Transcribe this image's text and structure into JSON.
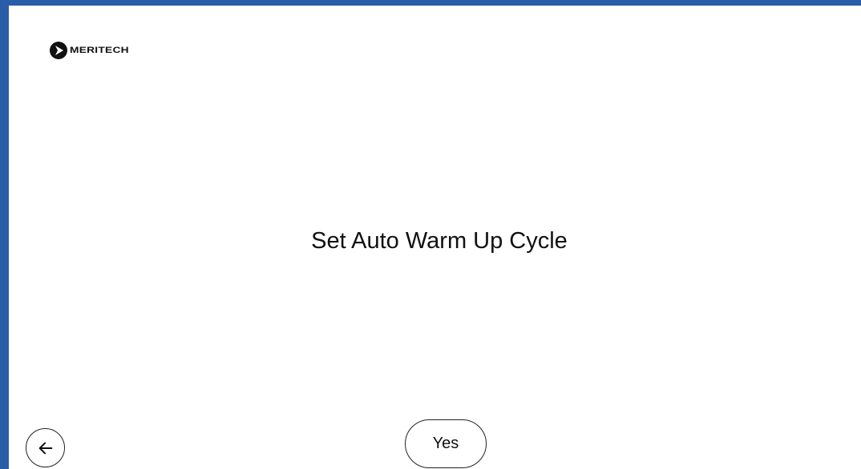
{
  "brand": {
    "name": "MERITECH",
    "logo_icon": "meritech-logo-icon"
  },
  "screen": {
    "title": "Set Auto Warm Up Cycle"
  },
  "actions": {
    "back_icon": "arrow-left-icon",
    "yes_label": "Yes"
  },
  "colors": {
    "frame_accent": "#2a5da8",
    "text": "#111111",
    "background": "#ffffff"
  }
}
